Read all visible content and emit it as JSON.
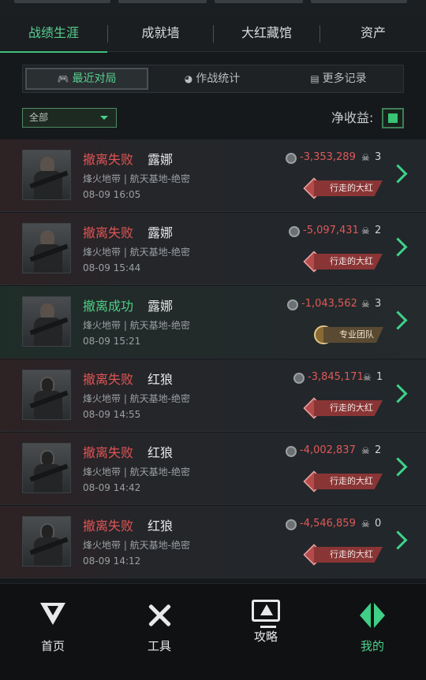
{
  "tabs": [
    {
      "label": "战绩生涯",
      "active": true
    },
    {
      "label": "成就墙",
      "active": false
    },
    {
      "label": "大红藏馆",
      "active": false
    },
    {
      "label": "资产",
      "active": false
    }
  ],
  "segments": [
    {
      "label": "最近对局",
      "icon": "gamepad-icon",
      "active": true
    },
    {
      "label": "作战统计",
      "icon": "pie-chart-icon",
      "active": false
    },
    {
      "label": "更多记录",
      "icon": "document-icon",
      "active": false
    }
  ],
  "filter": {
    "selected": "全部"
  },
  "net_income": {
    "label": "净收益:",
    "enabled": true
  },
  "records": [
    {
      "status": "撤离失败",
      "result": "fail",
      "operator": "露娜",
      "map": "烽火地带 | 航天基地-绝密",
      "time": "08-09 16:05",
      "amount": "-3,353,289",
      "kills": "3",
      "badge": "行走的大红",
      "badge_type": "red"
    },
    {
      "status": "撤离失败",
      "result": "fail",
      "operator": "露娜",
      "map": "烽火地带 | 航天基地-绝密",
      "time": "08-09 15:44",
      "amount": "-5,097,431",
      "kills": "2",
      "badge": "行走的大红",
      "badge_type": "red"
    },
    {
      "status": "撤离成功",
      "result": "ok",
      "operator": "露娜",
      "map": "烽火地带 | 航天基地-绝密",
      "time": "08-09 15:21",
      "amount": "-1,043,562",
      "kills": "3",
      "badge": "专业团队",
      "badge_type": "team"
    },
    {
      "status": "撤离失败",
      "result": "fail",
      "operator": "红狼",
      "map": "烽火地带 | 航天基地-绝密",
      "time": "08-09 14:55",
      "amount": "-3,845,171",
      "kills": "1",
      "badge": "行走的大红",
      "badge_type": "red"
    },
    {
      "status": "撤离失败",
      "result": "fail",
      "operator": "红狼",
      "map": "烽火地带 | 航天基地-绝密",
      "time": "08-09 14:42",
      "amount": "-4,002,837",
      "kills": "2",
      "badge": "行走的大红",
      "badge_type": "red"
    },
    {
      "status": "撤离失败",
      "result": "fail",
      "operator": "红狼",
      "map": "烽火地带 | 航天基地-绝密",
      "time": "08-09 14:12",
      "amount": "-4,546,859",
      "kills": "0",
      "badge": "行走的大红",
      "badge_type": "red"
    }
  ],
  "bottom_nav": [
    {
      "label": "首页",
      "icon": "home-icon",
      "active": false
    },
    {
      "label": "工具",
      "icon": "tools-icon",
      "active": false
    },
    {
      "label": "攻略",
      "icon": "guide-icon",
      "active": false
    },
    {
      "label": "我的",
      "icon": "me-icon",
      "active": true
    }
  ],
  "colors": {
    "accent": "#4fcf86",
    "fail": "#e15454",
    "badge_red": "#8a3535"
  }
}
